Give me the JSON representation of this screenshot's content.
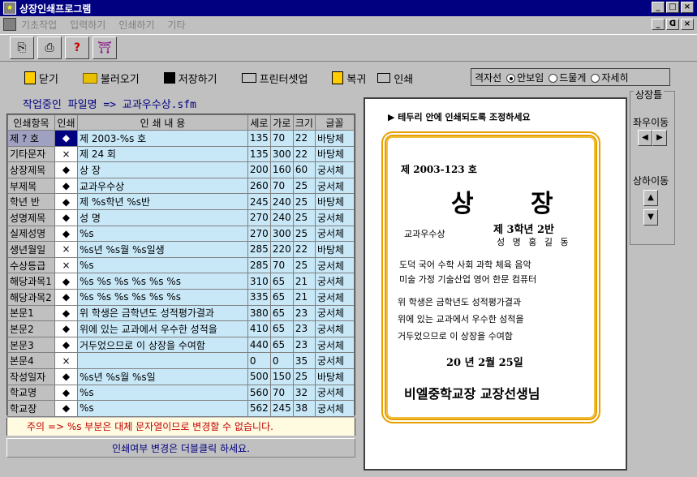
{
  "window": {
    "title": "상장인쇄프로그램",
    "minimize": "_",
    "maximize": "□",
    "close": "×"
  },
  "menu": [
    "기초작업",
    "입력하기",
    "인쇄하기",
    "기타"
  ],
  "mdi": {
    "minimize": "_",
    "restore": "ᗡ",
    "close": "×"
  },
  "toolbar2": {
    "close": "닫기",
    "load": "불러오기",
    "save": "저장하기",
    "printer_setup": "프린터셋업",
    "back": "복귀",
    "print": "인쇄"
  },
  "grid_options": {
    "label": "격자선",
    "opt1": "안보임",
    "opt2": "드물게",
    "opt3": "자세히",
    "selected": "안보임"
  },
  "file": {
    "label": "작업중인 파일명 =>  교과우수상.sfm"
  },
  "table": {
    "headers": [
      "인쇄항목",
      "인쇄",
      "인  쇄  내  용",
      "세로",
      "가로",
      "크기",
      "글꼴"
    ],
    "rows": [
      {
        "item": "제 ? 호",
        "mark": "◆",
        "content": "제 2003-%s 호",
        "v": "135",
        "h": "70",
        "s": "22",
        "font": "바탕체"
      },
      {
        "item": "기타문자",
        "mark": "×",
        "content": "제 24 회",
        "v": "135",
        "h": "300",
        "s": "22",
        "font": "바탕체"
      },
      {
        "item": "상장제목",
        "mark": "◆",
        "content": "상  장",
        "v": "200",
        "h": "160",
        "s": "60",
        "font": "궁서체"
      },
      {
        "item": "부제목",
        "mark": "◆",
        "content": "교과우수상",
        "v": "260",
        "h": "70",
        "s": "25",
        "font": "궁서체"
      },
      {
        "item": "학년 반",
        "mark": "◆",
        "content": "제 %s학년 %s반",
        "v": "245",
        "h": "240",
        "s": "25",
        "font": "바탕체"
      },
      {
        "item": "성명제목",
        "mark": "◆",
        "content": "성  명",
        "v": "270",
        "h": "240",
        "s": "25",
        "font": "궁서체"
      },
      {
        "item": "실제성명",
        "mark": "◆",
        "content": "%s",
        "v": "270",
        "h": "300",
        "s": "25",
        "font": "궁서체"
      },
      {
        "item": "생년월일",
        "mark": "×",
        "content": "%s년 %s월 %s일생",
        "v": "285",
        "h": "220",
        "s": "22",
        "font": "바탕체"
      },
      {
        "item": "수상등급",
        "mark": "×",
        "content": "%s",
        "v": "285",
        "h": "70",
        "s": "25",
        "font": "궁서체"
      },
      {
        "item": "해당과목1",
        "mark": "◆",
        "content": "%s %s %s %s %s %s",
        "v": "310",
        "h": "65",
        "s": "21",
        "font": "궁서체"
      },
      {
        "item": "해당과목2",
        "mark": "◆",
        "content": "%s %s %s %s %s %s",
        "v": "335",
        "h": "65",
        "s": "21",
        "font": "궁서체"
      },
      {
        "item": "본문1",
        "mark": "◆",
        "content": "  위 학생은 금학년도 성적평가결과",
        "v": "380",
        "h": "65",
        "s": "23",
        "font": "궁서체"
      },
      {
        "item": "본문2",
        "mark": "◆",
        "content": "위에 있는 교과에서 우수한 성적을",
        "v": "410",
        "h": "65",
        "s": "23",
        "font": "궁서체"
      },
      {
        "item": "본문3",
        "mark": "◆",
        "content": "거두었으므로 이 상장을 수여함",
        "v": "440",
        "h": "65",
        "s": "23",
        "font": "궁서체"
      },
      {
        "item": "본문4",
        "mark": "×",
        "content": "",
        "v": "0",
        "h": "0",
        "s": "35",
        "font": "궁서체"
      },
      {
        "item": "작성일자",
        "mark": "◆",
        "content": "%s년 %s월 %s일",
        "v": "500",
        "h": "150",
        "s": "25",
        "font": "바탕체"
      },
      {
        "item": "학교명",
        "mark": "◆",
        "content": "%s",
        "v": "560",
        "h": "70",
        "s": "32",
        "font": "궁서체"
      },
      {
        "item": "학교장",
        "mark": "◆",
        "content": "%s",
        "v": "562",
        "h": "245",
        "s": "38",
        "font": "궁서체"
      }
    ]
  },
  "notice": "주의 => %s 부분은 대체 문자열이므로 변경할 수 없습니다.",
  "hint": "인쇄여부 변경은 더블클릭 하세요.",
  "preview": {
    "tip": "▶ 테두리 안에 인쇄되도록 조정하세요",
    "no": "제  2003-123  호",
    "title": "상 장",
    "award": "교과우수상",
    "grade": "제 3학년 2반",
    "name": "성 명 홍 길 동",
    "subjects1": "도덕 국어 수학 사회 과학 체육 음악",
    "subjects2": "미술 가정 기술산업 영어 한문 컴퓨터",
    "body1": "  위 학생은 금학년도 성적평가결과",
    "body2": "위에 있는 교과에서 우수한 성적을",
    "body3": "거두었으므로 이 상장을 수여함",
    "date": "20  년 2월 25일",
    "sign": "비엘중학교장 교장선생님"
  },
  "side": {
    "title": "상장틀",
    "lr": "좌우이동",
    "ud": "상하이동",
    "left": "◀",
    "right": "▶",
    "up": "▲",
    "down": "▼"
  }
}
